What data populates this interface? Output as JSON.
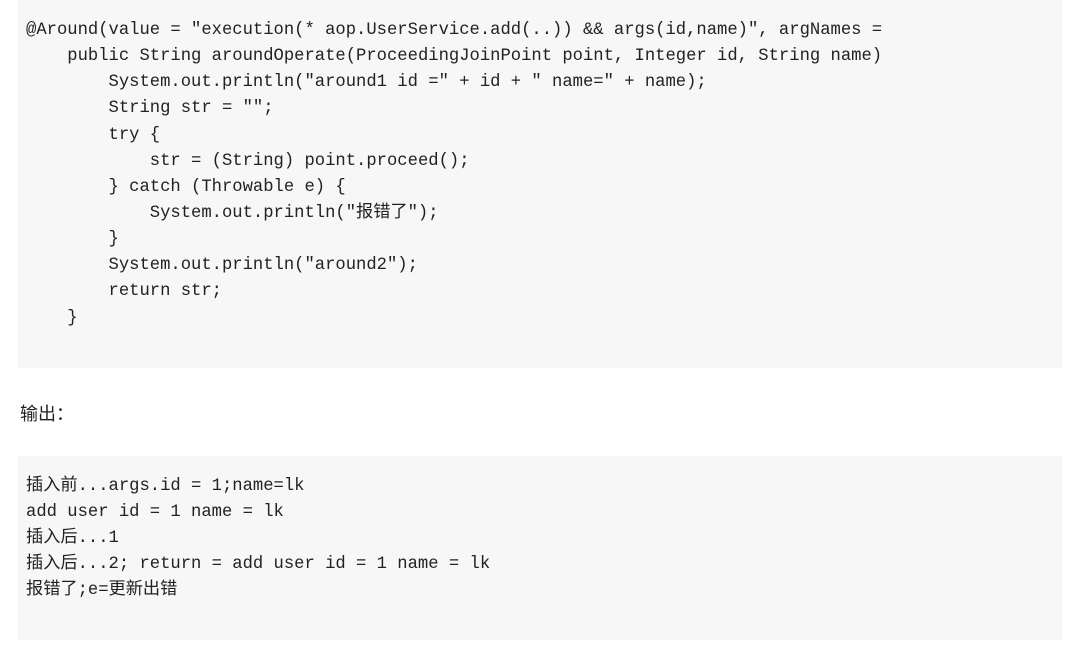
{
  "code_block_1": "@Around(value = \"execution(* aop.UserService.add(..)) && args(id,name)\", argNames =\n    public String aroundOperate(ProceedingJoinPoint point, Integer id, String name)\n        System.out.println(\"around1 id =\" + id + \" name=\" + name);\n        String str = \"\";\n        try {\n            str = (String) point.proceed();\n        } catch (Throwable e) {\n            System.out.println(\"报错了\");\n        }\n        System.out.println(\"around2\");\n        return str;\n    }",
  "section_label": "输出：",
  "code_block_2": "插入前...args.id = 1;name=lk\nadd user id = 1 name = lk\n插入后...1\n插入后...2; return = add user id = 1 name = lk\n报错了;e=更新出错"
}
